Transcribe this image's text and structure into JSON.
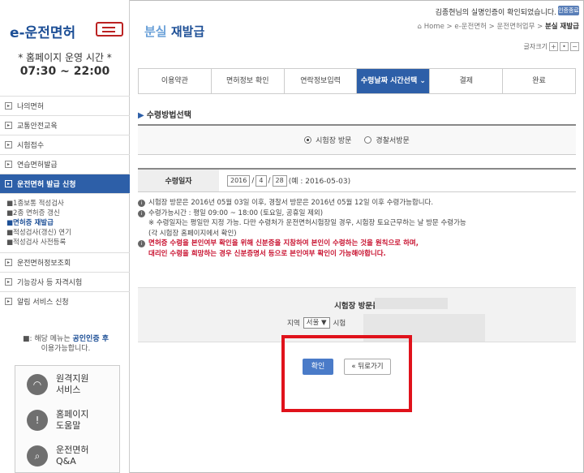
{
  "sidebar": {
    "logo": "e-운전면허",
    "hours_title": "* 홈페이지 운영 시간 *",
    "hours": "07:30 ~ 22:00",
    "menu_top": [
      {
        "label": "나의면허"
      },
      {
        "label": "교통안전교육"
      },
      {
        "label": "시험접수"
      },
      {
        "label": "연습면허발급"
      },
      {
        "label": "운전면허 발급 신청",
        "active": true
      }
    ],
    "sub_items": [
      "1종보통 적성검사",
      "2종 면허증 갱신",
      "면허증 재발급",
      "적성검사(갱신) 연기",
      "적성검사 사전등록"
    ],
    "menu_bottom": [
      {
        "label": "운전면허정보조회"
      },
      {
        "label": "기능강사 등 자격시험"
      },
      {
        "label": "알림 서비스 신청"
      }
    ],
    "notice_prefix": "해당 메뉴는",
    "notice_highlight": "공인인증 후",
    "notice_suffix": "이용가능합니다.",
    "buttons": [
      {
        "line1": "원격지원",
        "line2": "서비스"
      },
      {
        "line1": "홈페이지",
        "line2": "도움말"
      },
      {
        "line1": "운전면허",
        "line2": "Q&A"
      }
    ]
  },
  "header": {
    "title": "분실",
    "title_rest": "재발급",
    "auth_message": "김종현님의 실명인증이 확인되었습니다.",
    "logout": "인증종료",
    "breadcrumb": "Home > e-운전면허 > 운전면허업무 >",
    "breadcrumb_current": "분실 재발급",
    "font_label": "글자크기"
  },
  "steps": [
    {
      "label": "이용약관"
    },
    {
      "label": "면허정보 확인"
    },
    {
      "label": "연락정보입력"
    },
    {
      "label": "수령날짜 시간선택 ⌄",
      "active": true
    },
    {
      "label": "결제"
    },
    {
      "label": "완료"
    }
  ],
  "method": {
    "section_title": "수령방법선택",
    "option1": "시험장 방문",
    "option2": "경찰서방문"
  },
  "date": {
    "label": "수령일자",
    "year": "2016",
    "month": "4",
    "day": "28",
    "example": "(예 : 2016-05-03)"
  },
  "info": {
    "line1": "시험장 방문은 2016년 05월 03일 이후, 경찰서 방문은 2016년 05월 12일 이후 수령가능합니다.",
    "line2": "수령가능시간 : 평일 09:00 ~ 18:00 (토요일, 공휴일 제외)",
    "line3": "※ 수령일자는 평일만 지정 가능. 다만 수령처가 운전면허시험장일 경우, 시험장 토요근무하는 날 방문 수령가능",
    "line4": "(각 시험장 홈페이지에서 확인)",
    "line5": "면허증 수령을 본인여부 확인을 위해 신분증을 지참하여 본인이 수령하는 것을 원칙으로 하며,",
    "line6": "대리인 수령을 희망하는 경우 신분증명서 등으로 본인여부 확인이 가능해야합니다."
  },
  "visit": {
    "title": "시험장 방문률",
    "region_label": "지역",
    "region_value": "서울 ▼",
    "exam_label": "시험"
  },
  "actions": {
    "confirm": "확인",
    "back": "« 뒤로가기"
  },
  "colors": {
    "brand": "#1d4f96",
    "active_tab": "#2d5fa8",
    "highlight_box": "#e0121b"
  }
}
